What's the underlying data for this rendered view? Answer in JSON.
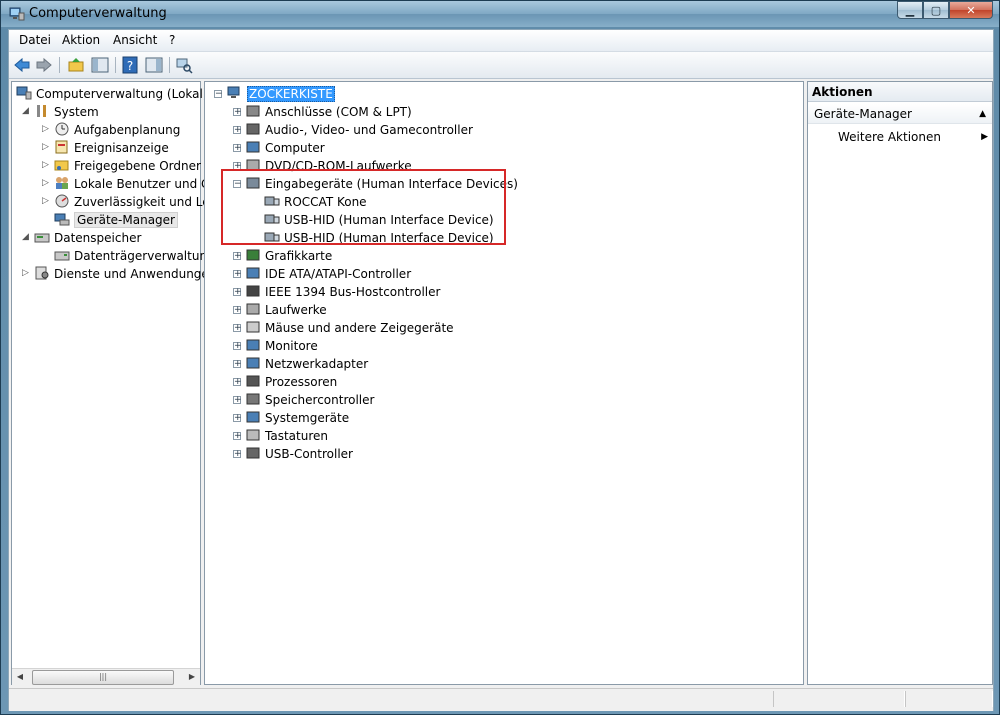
{
  "window": {
    "title": "Computerverwaltung"
  },
  "menu": {
    "datei": "Datei",
    "aktion": "Aktion",
    "ansicht": "Ansicht",
    "help": "?"
  },
  "left_tree": {
    "root": "Computerverwaltung (Lokal)",
    "system": "System",
    "aufgabenplanung": "Aufgabenplanung",
    "ereignisanzeige": "Ereignisanzeige",
    "freigegebene_ordner": "Freigegebene Ordner",
    "lokale_benutzer": "Lokale Benutzer und Gr",
    "zuverlaessigkeit": "Zuverlässigkeit und Leis",
    "geraete_manager": "Geräte-Manager",
    "datenspeicher": "Datenspeicher",
    "datentraeger": "Datenträgerverwaltung",
    "dienste": "Dienste und Anwendungen"
  },
  "device_tree": {
    "computer_name": "ZOCKERKISTE",
    "categories": [
      "Anschlüsse (COM & LPT)",
      "Audio-, Video- und Gamecontroller",
      "Computer",
      "DVD/CD-ROM-Laufwerke",
      "Eingabegeräte (Human Interface Devices)",
      "Grafikkarte",
      "IDE ATA/ATAPI-Controller",
      "IEEE 1394 Bus-Hostcontroller",
      "Laufwerke",
      "Mäuse und andere Zeigegeräte",
      "Monitore",
      "Netzwerkadapter",
      "Prozessoren",
      "Speichercontroller",
      "Systemgeräte",
      "Tastaturen",
      "USB-Controller"
    ],
    "hid_devices": [
      "ROCCAT Kone",
      "USB-HID (Human Interface Device)",
      "USB-HID (Human Interface Device)"
    ]
  },
  "actions": {
    "header": "Aktionen",
    "section": "Geräte-Manager",
    "more": "Weitere Aktionen"
  },
  "colors": {
    "highlight_box": "#d62828",
    "selection": "#3399ff"
  }
}
